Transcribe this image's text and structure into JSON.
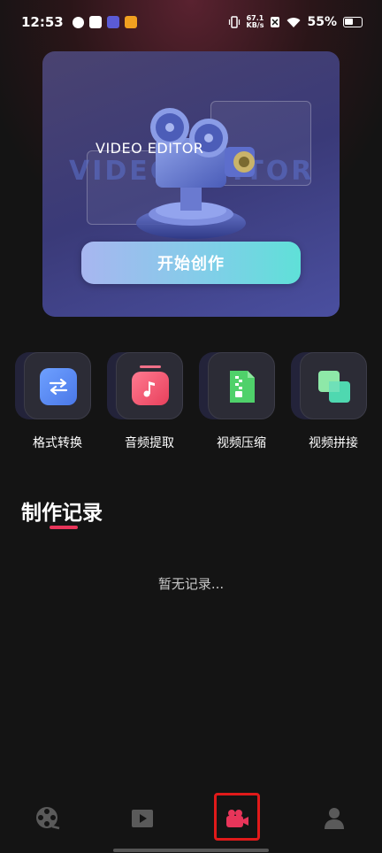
{
  "status_bar": {
    "time": "12:53",
    "net_speed_value": "67.1",
    "net_speed_unit": "KB/s",
    "battery_percent": "55%",
    "battery_level": 0.55
  },
  "hero": {
    "title": "VIDEO EDITOR",
    "bg_title": "VIDEO EDITOR",
    "start_button_label": "开始创作"
  },
  "tools": [
    {
      "label": "格式转换",
      "icon": "swap-arrows-icon",
      "color": "#5b8df5"
    },
    {
      "label": "音频提取",
      "icon": "music-note-icon",
      "color": "#f0506e"
    },
    {
      "label": "视频压缩",
      "icon": "zip-file-icon",
      "color": "#4fd16a"
    },
    {
      "label": "视频拼接",
      "icon": "overlap-squares-icon",
      "color": "#4fd8a8"
    }
  ],
  "records": {
    "title": "制作记录",
    "empty_text": "暂无记录..."
  },
  "bottom_nav": {
    "items": [
      {
        "icon": "film-reel-icon",
        "active": false
      },
      {
        "icon": "play-icon",
        "active": false
      },
      {
        "icon": "video-camera-icon",
        "active": true
      },
      {
        "icon": "user-icon",
        "active": false
      }
    ],
    "accent": "#e8355a"
  }
}
